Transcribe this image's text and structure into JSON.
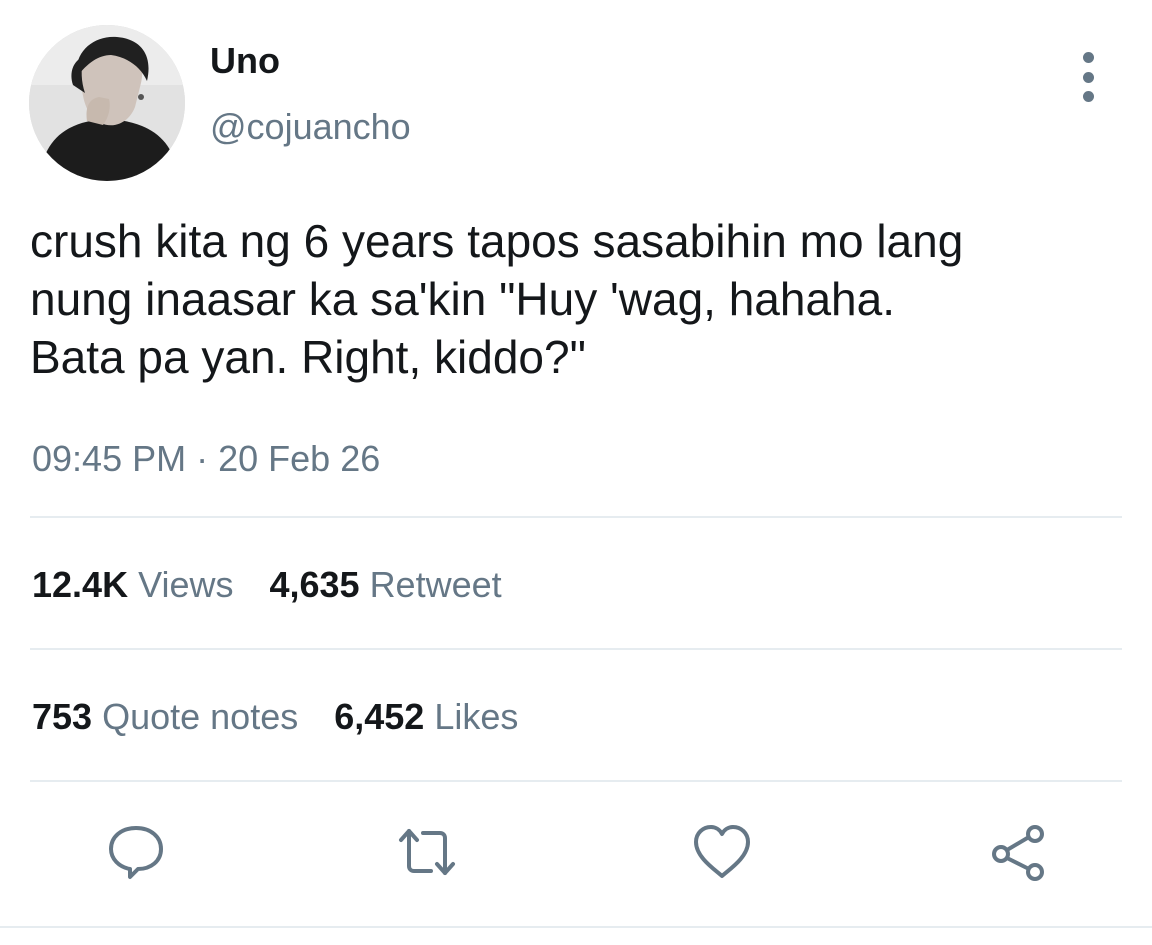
{
  "user": {
    "display_name": "Uno",
    "handle": "@cojuancho"
  },
  "tweet": {
    "text": "crush kita ng 6 years tapos sasabihin mo lang\nnung inaasar ka sa'kin \"Huy 'wag, hahaha.\nBata pa yan. Right, kiddo?\"",
    "time": "09:45 PM",
    "separator": "·",
    "date": "20 Feb 26"
  },
  "stats": {
    "views_count": "12.4K",
    "views_label": "Views",
    "retweet_count": "4,635",
    "retweet_label": "Retweet",
    "quote_count": "753",
    "quote_label": "Quote notes",
    "likes_count": "6,452",
    "likes_label": "Likes"
  },
  "actions": [
    "reply-icon",
    "retweet-icon",
    "like-icon",
    "share-icon"
  ],
  "colors": {
    "text": "#14171a",
    "secondary": "#657786",
    "divider": "#e6ecf0",
    "background": "#ffffff"
  }
}
